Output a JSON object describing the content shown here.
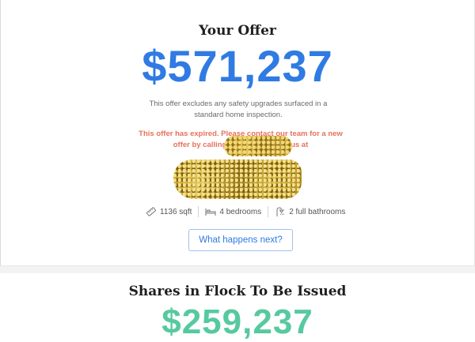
{
  "offer": {
    "title": "Your Offer",
    "amount": "$571,237",
    "disclaimer": "This offer excludes any safety upgrades surfaced in a standard home inspection.",
    "expired_notice": "This offer has expired. Please contact our team for a new offer by calling us at                        or emailing us at"
  },
  "features": [
    {
      "icon": "ruler-icon",
      "label": "1136 sqft"
    },
    {
      "icon": "bed-icon",
      "label": "4 bedrooms"
    },
    {
      "icon": "shower-icon",
      "label": "2 full bathrooms"
    }
  ],
  "cta": {
    "label": "What happens next?"
  },
  "shares": {
    "title": "Shares in Flock To Be Issued",
    "amount": "$259,237"
  },
  "colors": {
    "offer_amount": "#2f7be3",
    "shares_amount": "#57c9a0",
    "expired_text": "#e8705a",
    "redaction": "#c9a52c"
  }
}
